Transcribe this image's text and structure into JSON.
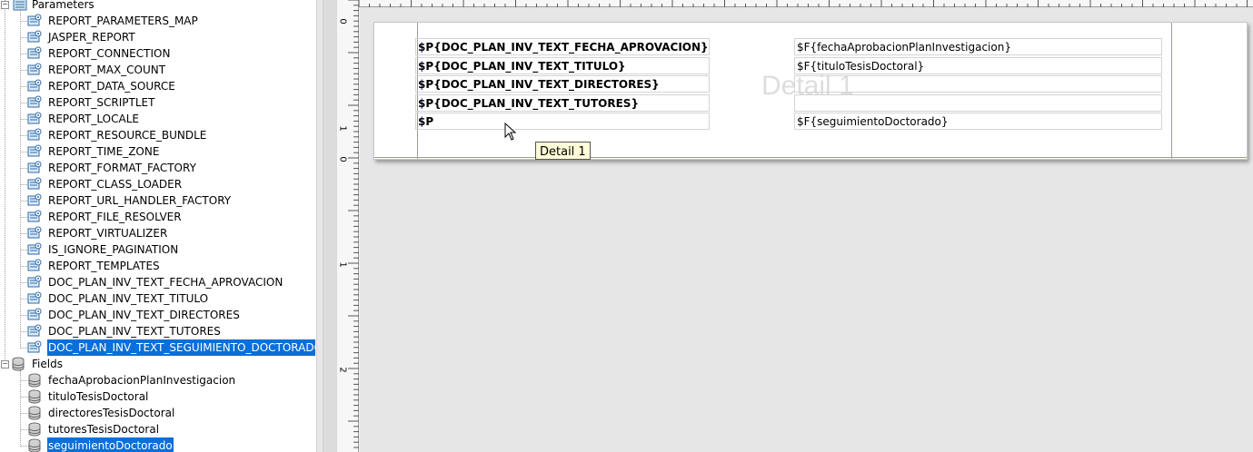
{
  "tree": {
    "parameters_label": "Parameters",
    "fields_label": "Fields",
    "parameters": [
      "REPORT_PARAMETERS_MAP",
      "JASPER_REPORT",
      "REPORT_CONNECTION",
      "REPORT_MAX_COUNT",
      "REPORT_DATA_SOURCE",
      "REPORT_SCRIPTLET",
      "REPORT_LOCALE",
      "REPORT_RESOURCE_BUNDLE",
      "REPORT_TIME_ZONE",
      "REPORT_FORMAT_FACTORY",
      "REPORT_CLASS_LOADER",
      "REPORT_URL_HANDLER_FACTORY",
      "REPORT_FILE_RESOLVER",
      "REPORT_VIRTUALIZER",
      "IS_IGNORE_PAGINATION",
      "REPORT_TEMPLATES",
      "DOC_PLAN_INV_TEXT_FECHA_APROVACION",
      "DOC_PLAN_INV_TEXT_TITULO",
      "DOC_PLAN_INV_TEXT_DIRECTORES",
      "DOC_PLAN_INV_TEXT_TUTORES",
      "DOC_PLAN_INV_TEXT_SEGUIMIENTO_DOCTORADO"
    ],
    "fields": [
      "fechaAprobacionPlanInvestigacion",
      "tituloTesisDoctoral",
      "directoresTesisDoctoral",
      "tutoresTesisDoctoral",
      "seguimientoDoctorado"
    ]
  },
  "rulers": {
    "vertical_marks": [
      "0",
      "1",
      "0",
      "1",
      "2"
    ]
  },
  "band": {
    "watermark": "Detail 1",
    "tooltip": "Detail 1",
    "param_cells": [
      "$P{DOC_PLAN_INV_TEXT_FECHA_APROVACION}",
      "$P{DOC_PLAN_INV_TEXT_TITULO}",
      "$P{DOC_PLAN_INV_TEXT_DIRECTORES}",
      "$P{DOC_PLAN_INV_TEXT_TUTORES}",
      "$P"
    ],
    "field_cells": [
      "$F{fechaAprobacionPlanInvestigacion}",
      "$F{tituloTesisDoctoral}",
      "",
      "",
      "$F{seguimientoDoctorado}"
    ]
  },
  "colors": {
    "selection": "#0a6fd8",
    "band_line": "#a090d8"
  }
}
